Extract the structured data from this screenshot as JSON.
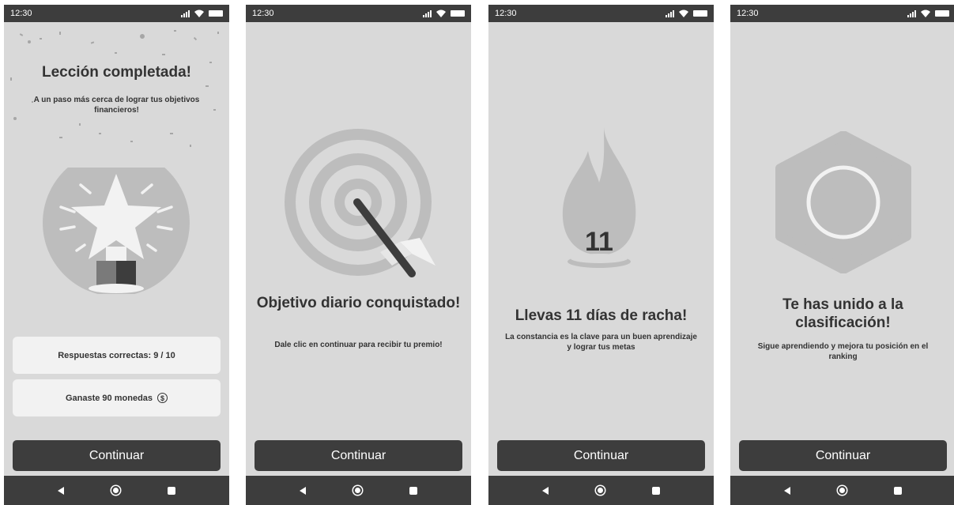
{
  "status_bar": {
    "time": "12:30"
  },
  "screens": [
    {
      "title": "Lección completada!",
      "subtitle": "A un paso más cerca de lograr tus objetivos financieros!",
      "cards": [
        {
          "label": "Respuestas correctas: 9 / 10"
        },
        {
          "label": "Ganaste 90 monedas",
          "icon": "coin-icon",
          "icon_glyph": "$"
        }
      ],
      "button": "Continuar",
      "illustration": "star-trophy-icon"
    },
    {
      "title": "Objetivo diario conquistado!",
      "subtitle": "Dale clic en continuar para recibir tu premio!",
      "button": "Continuar",
      "illustration": "target-icon"
    },
    {
      "title": "Llevas 11 días de racha!",
      "subtitle": "La constancia es la clave para un buen aprendizaje y lograr tus metas",
      "streak": "11",
      "button": "Continuar",
      "illustration": "flame-icon"
    },
    {
      "title": "Te has unido a la clasificación!",
      "subtitle": "Sigue aprendiendo y mejora tu posición en el ranking",
      "button": "Continuar",
      "illustration": "hexagon-badge-icon"
    }
  ],
  "colors": {
    "background": "#d9d9d9",
    "dark": "#3d3d3d",
    "card": "#f2f2f2",
    "accent_gray": "#bdbdbd"
  }
}
